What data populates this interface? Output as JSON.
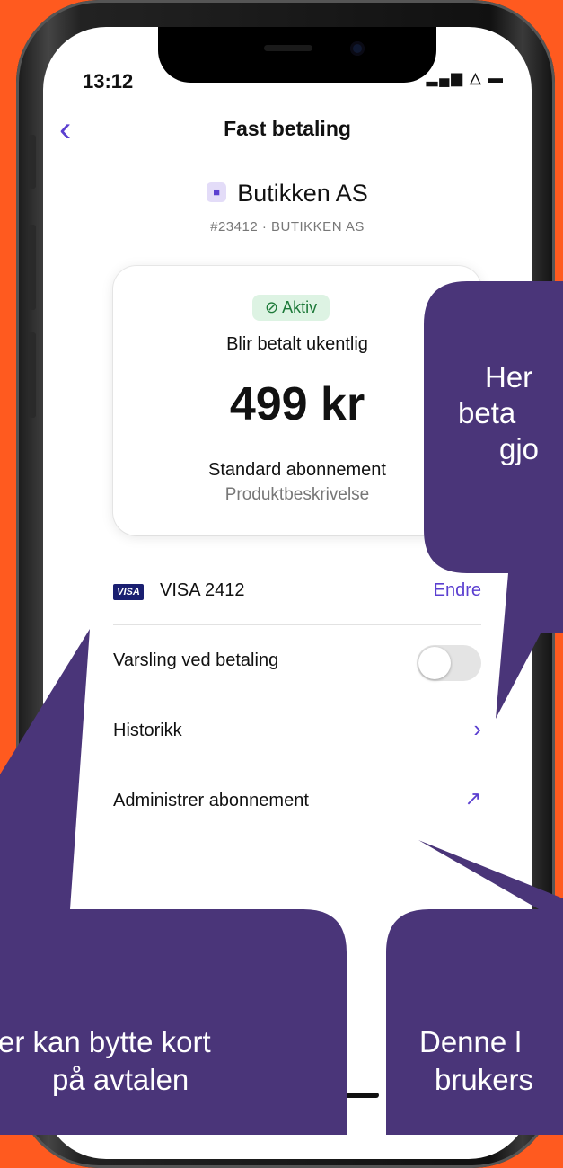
{
  "status": {
    "time": "13:12",
    "icons": "▂▄▆ △ ▬"
  },
  "nav": {
    "back_icon": "chevron-left-icon",
    "title": "Fast betaling"
  },
  "merchant": {
    "name": "Butikken AS",
    "subtitle": "#23412 · BUTIKKEN AS"
  },
  "card": {
    "status_badge": "⊘ Aktiv",
    "frequency": "Blir betalt ukentlig",
    "amount": "499 kr",
    "plan_name": "Standard abonnement",
    "plan_description": "Produktbeskrivelse"
  },
  "rows": {
    "payment": {
      "card_brand": "VISA",
      "label": "VISA 2412",
      "action": "Endre"
    },
    "notify": {
      "label": "Varsling ved betaling",
      "toggle_on": false
    },
    "history": {
      "label": "Historikk",
      "icon": "›"
    },
    "manage": {
      "label": "Administrer abonnement",
      "icon": "↗"
    }
  },
  "callouts": {
    "right_top": {
      "lines": [
        "Her",
        "beta",
        "gjo"
      ]
    },
    "left_bottom": {
      "lines": [
        "er kan bytte kort",
        "på avtalen"
      ]
    },
    "right_bottom": {
      "lines": [
        "Denne l",
        "brukers"
      ]
    }
  },
  "colors": {
    "accent": "#5B3FD0",
    "background": "#FF5A1F",
    "callout": "#4A3579",
    "active_badge": "#DDF3E3"
  }
}
